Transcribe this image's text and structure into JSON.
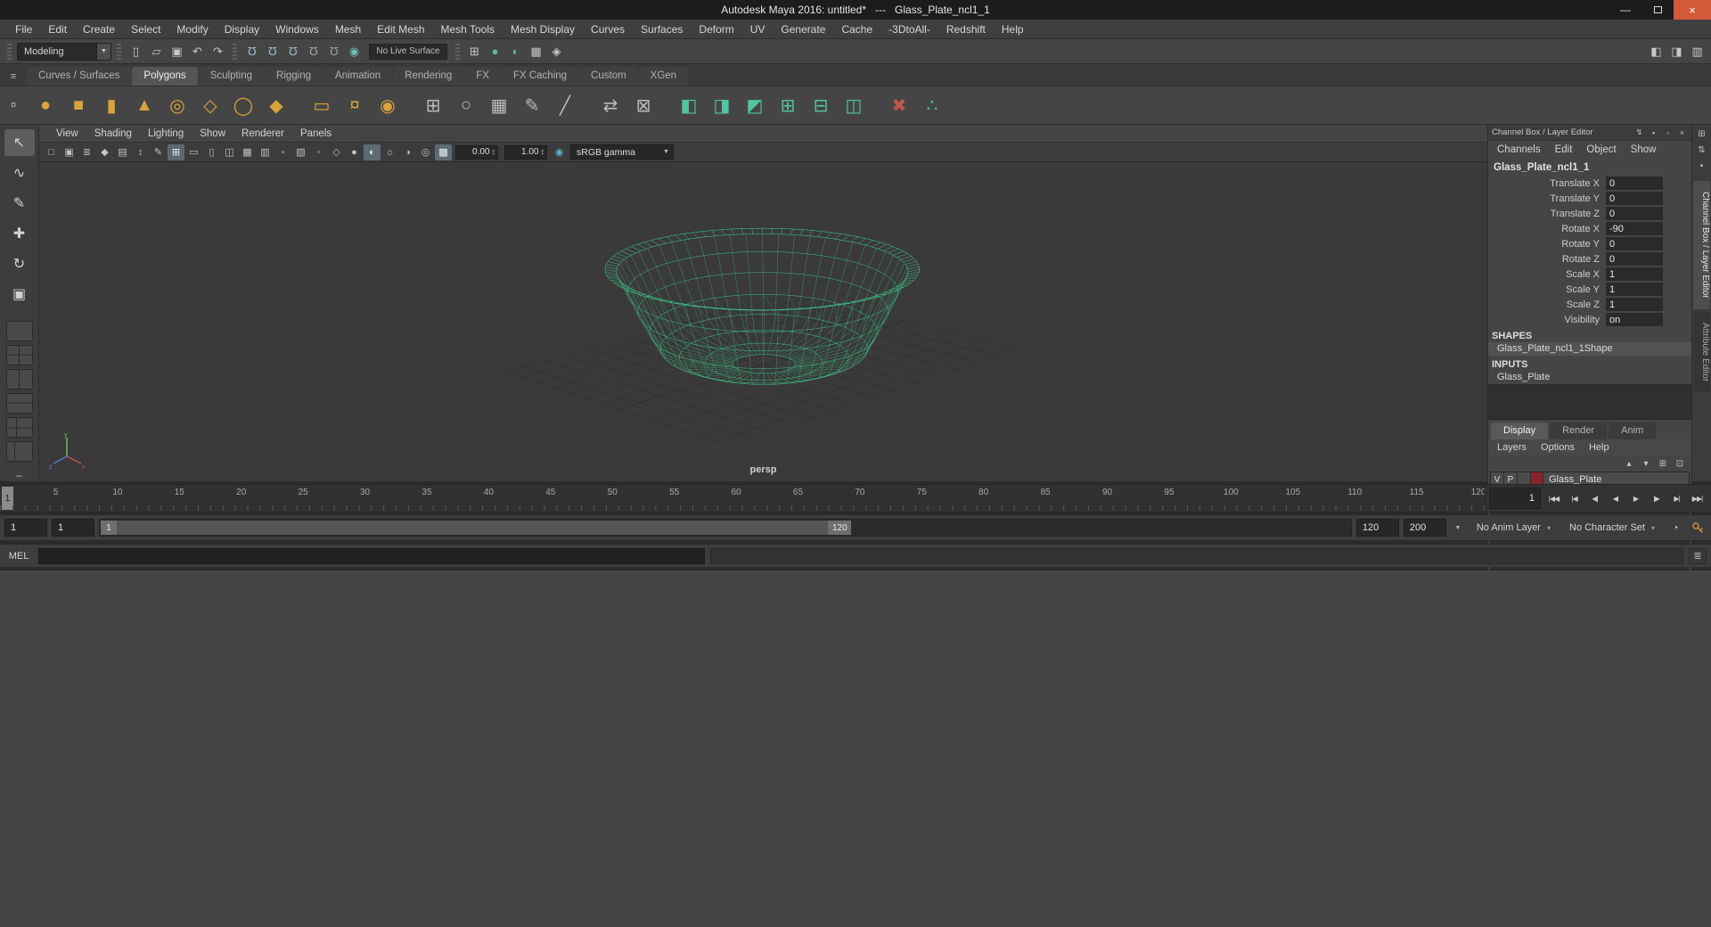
{
  "titlebar": {
    "title": "Autodesk Maya 2016: untitled*   ---   Glass_Plate_ncl1_1"
  },
  "menubar": {
    "items": [
      "File",
      "Edit",
      "Create",
      "Select",
      "Modify",
      "Display",
      "Windows",
      "Mesh",
      "Edit Mesh",
      "Mesh Tools",
      "Mesh Display",
      "Curves",
      "Surfaces",
      "Deform",
      "UV",
      "Generate",
      "Cache",
      "-3DtoAll-",
      "Redshift",
      "Help"
    ]
  },
  "statusline": {
    "menuset": "Modeling",
    "live_surface": "No Live Surface",
    "file_icons": [
      {
        "name": "new-scene-button",
        "icon": "new-scene-icon",
        "glyph": "▯"
      },
      {
        "name": "open-scene-button",
        "icon": "open-folder-icon",
        "glyph": "▱"
      },
      {
        "name": "save-scene-button",
        "icon": "save-icon",
        "glyph": "▣"
      },
      {
        "name": "undo-button",
        "icon": "undo-icon",
        "glyph": "↶"
      },
      {
        "name": "redo-button",
        "icon": "redo-icon",
        "glyph": "↷"
      }
    ],
    "snap_icons": [
      {
        "name": "snap-to-grid-button",
        "icon": "snap-grid-magnet-icon",
        "glyph": "Ω",
        "cls": "magnet",
        "color": "#9ec2d4"
      },
      {
        "name": "snap-to-curve-button",
        "icon": "snap-curve-magnet-icon",
        "glyph": "Ω",
        "cls": "magnet",
        "color": "#9ec2d4"
      },
      {
        "name": "snap-to-point-button",
        "icon": "snap-point-magnet-icon",
        "glyph": "Ω",
        "cls": "magnet",
        "color": "#9ec2d4"
      },
      {
        "name": "snap-to-projected-center-button",
        "icon": "snap-projected-magnet-icon",
        "glyph": "Ω",
        "cls": "magnet",
        "color": "#a9a9a9"
      },
      {
        "name": "snap-to-view-plane-button",
        "icon": "snap-view-plane-magnet-icon",
        "glyph": "Ω",
        "cls": "magnet",
        "color": "#a9a9a9"
      },
      {
        "name": "make-live-button",
        "icon": "make-live-icon",
        "glyph": "◉",
        "color": "#6fc0b5"
      }
    ],
    "render_icons": [
      {
        "name": "open-render-view-button",
        "icon": "render-view-icon",
        "glyph": "⊞"
      },
      {
        "name": "render-current-frame-button",
        "icon": "render-ball-icon",
        "glyph": "●",
        "color": "#5fb8a5"
      },
      {
        "name": "ipr-render-button",
        "icon": "ipr-render-icon",
        "glyph": "◐",
        "color": "#5fb8a5"
      },
      {
        "name": "render-settings-button",
        "icon": "render-settings-icon",
        "glyph": "▦"
      },
      {
        "name": "hypershade-button",
        "icon": "hypershade-icon",
        "glyph": "◈"
      }
    ],
    "right_icons": [
      {
        "name": "toggle-sidebar-left-button",
        "icon": "sidebar-left-icon",
        "glyph": "◧"
      },
      {
        "name": "toggle-sidebar-right-button",
        "icon": "sidebar-right-icon",
        "glyph": "◨"
      },
      {
        "name": "toggle-workspace-button",
        "icon": "workspace-grid-icon",
        "glyph": "▥"
      }
    ]
  },
  "shelf": {
    "menu_glyph": "≡",
    "gear_glyph": "¤",
    "tabs": [
      {
        "label": "Curves / Surfaces"
      },
      {
        "label": "Polygons",
        "active": true
      },
      {
        "label": "Sculpting"
      },
      {
        "label": "Rigging"
      },
      {
        "label": "Animation"
      },
      {
        "label": "Rendering"
      },
      {
        "label": "FX"
      },
      {
        "label": "FX Caching"
      },
      {
        "label": "Custom"
      },
      {
        "label": "XGen"
      }
    ],
    "icons": [
      {
        "name": "poly-sphere-button",
        "icon": "poly-sphere-icon",
        "glyph": "●",
        "color": "#d9a43c"
      },
      {
        "name": "poly-cube-button",
        "icon": "poly-cube-icon",
        "glyph": "■",
        "color": "#d9a43c"
      },
      {
        "name": "poly-cylinder-button",
        "icon": "poly-cylinder-icon",
        "glyph": "▮",
        "color": "#d9a43c"
      },
      {
        "name": "poly-cone-button",
        "icon": "poly-cone-icon",
        "glyph": "▲",
        "color": "#d9a43c"
      },
      {
        "name": "poly-torus-button",
        "icon": "poly-torus-icon",
        "glyph": "◎",
        "color": "#d9a43c"
      },
      {
        "name": "poly-plane-button",
        "icon": "poly-plane-icon",
        "glyph": "◇",
        "color": "#d9a43c"
      },
      {
        "name": "poly-disc-button",
        "icon": "poly-disc-icon",
        "glyph": "◯",
        "color": "#d9a43c"
      },
      {
        "name": "poly-platonic-button",
        "icon": "poly-platonic-icon",
        "glyph": "◆",
        "color": "#d9a43c"
      },
      {
        "name": "poly-pipe-button",
        "icon": "poly-pipe-icon",
        "glyph": "▭",
        "color": "#d9a43c",
        "gap": true
      },
      {
        "name": "poly-gear-button",
        "icon": "poly-gear-icon",
        "glyph": "¤",
        "color": "#d9a43c"
      },
      {
        "name": "poly-soccer-ball-button",
        "icon": "poly-soccer-ball-icon",
        "glyph": "◉",
        "color": "#d9a43c"
      },
      {
        "name": "sculpt-tool-button",
        "icon": "sculpt-grid-icon",
        "glyph": "⊞",
        "color": "#bcbcbc",
        "gap": true
      },
      {
        "name": "smooth-button",
        "icon": "smooth-icon",
        "glyph": "○",
        "color": "#bcbcbc"
      },
      {
        "name": "subdivide-button",
        "icon": "subdivide-icon",
        "glyph": "▦",
        "color": "#bcbcbc"
      },
      {
        "name": "quad-draw-button",
        "icon": "quad-draw-pencil-icon",
        "glyph": "✎",
        "color": "#bcbcbc"
      },
      {
        "name": "multi-cut-button",
        "icon": "multi-cut-icon",
        "glyph": "╱",
        "color": "#bcbcbc"
      },
      {
        "name": "target-weld-button",
        "icon": "target-weld-icon",
        "glyph": "⇄",
        "color": "#bcbcbc",
        "gap": true
      },
      {
        "name": "extrude-button",
        "icon": "extrude-icon",
        "glyph": "⊠",
        "color": "#bcbcbc"
      },
      {
        "name": "boolean-union-button",
        "icon": "boolean-union-icon",
        "glyph": "◧",
        "color": "#53c3a4",
        "gap": true
      },
      {
        "name": "boolean-difference-button",
        "icon": "boolean-difference-icon",
        "glyph": "◨",
        "color": "#53c3a4"
      },
      {
        "name": "boolean-intersection-button",
        "icon": "boolean-intersection-icon",
        "glyph": "◩",
        "color": "#53c3a4"
      },
      {
        "name": "combine-button",
        "icon": "combine-icon",
        "glyph": "⊞",
        "color": "#53c3a4"
      },
      {
        "name": "separate-button",
        "icon": "separate-icon",
        "glyph": "⊟",
        "color": "#53c3a4"
      },
      {
        "name": "mirror-button",
        "icon": "mirror-icon",
        "glyph": "◫",
        "color": "#53c3a4"
      },
      {
        "name": "delete-history-button",
        "icon": "delete-cross-icon",
        "glyph": "✖",
        "color": "#c0564a",
        "gap": true
      },
      {
        "name": "symmetry-button",
        "icon": "symmetry-icon",
        "glyph": "∴",
        "color": "#53c3a4"
      }
    ]
  },
  "toolbox": {
    "tools": [
      {
        "name": "select-tool",
        "icon": "select-arrow-icon",
        "glyph": "↖",
        "active": true
      },
      {
        "name": "lasso-tool",
        "icon": "lasso-icon",
        "glyph": "∿"
      },
      {
        "name": "paint-select-tool",
        "icon": "paint-brush-icon",
        "glyph": "✎"
      },
      {
        "name": "move-tool",
        "icon": "move-cross-icon",
        "glyph": "✚"
      },
      {
        "name": "rotate-tool",
        "icon": "rotate-icon",
        "glyph": "↻"
      },
      {
        "name": "scale-tool",
        "icon": "scale-icon",
        "glyph": "▣"
      }
    ],
    "layouts": [
      {
        "name": "layout-single-pane-button",
        "icon": "single-pane-icon",
        "cls": "lay-single"
      },
      {
        "name": "layout-four-pane-button",
        "icon": "four-pane-icon",
        "cls": "lay-four"
      },
      {
        "name": "layout-two-pane-side-button",
        "icon": "two-pane-side-icon",
        "cls": "lay-v"
      },
      {
        "name": "layout-two-pane-stacked-button",
        "icon": "two-pane-stacked-icon",
        "cls": "lay-h"
      },
      {
        "name": "layout-three-pane-button",
        "icon": "three-pane-icon",
        "cls": "lay-three"
      },
      {
        "name": "layout-outliner-persp-button",
        "icon": "outliner-pane-icon",
        "cls": "lay-left"
      }
    ],
    "more_glyph": "–"
  },
  "viewport": {
    "menus": [
      "View",
      "Shading",
      "Lighting",
      "Show",
      "Renderer",
      "Panels"
    ],
    "toolbar_icons": [
      {
        "name": "select-camera-button",
        "icon": "camera-icon",
        "glyph": "□"
      },
      {
        "name": "lock-camera-button",
        "icon": "lock-icon",
        "glyph": "▣"
      },
      {
        "name": "camera-attributes-button",
        "icon": "camera-attributes-icon",
        "glyph": "≣"
      },
      {
        "name": "bookmarks-button",
        "icon": "bookmark-icon",
        "glyph": "◆"
      },
      {
        "name": "image-plane-button",
        "icon": "image-plane-icon",
        "glyph": "▤"
      },
      {
        "name": "pan-zoom-button",
        "icon": "pan-zoom-icon",
        "glyph": "↕"
      },
      {
        "name": "grease-pencil-button",
        "icon": "grease-pencil-icon",
        "glyph": "✎"
      },
      {
        "name": "grid-toggle-button",
        "icon": "grid-icon",
        "glyph": "⊞",
        "active": true
      },
      {
        "name": "film-gate-button",
        "icon": "film-gate-icon",
        "glyph": "▭"
      },
      {
        "name": "resolution-gate-button",
        "icon": "resolution-gate-icon",
        "glyph": "▯"
      },
      {
        "name": "gate-mask-button",
        "icon": "gate-mask-icon",
        "glyph": "◫"
      },
      {
        "name": "field-chart-button",
        "icon": "field-chart-icon",
        "glyph": "▦"
      },
      {
        "name": "safe-action-button",
        "icon": "safe-action-icon",
        "glyph": "▥"
      },
      {
        "name": "safe-title-button",
        "icon": "safe-title-icon",
        "glyph": "▫"
      },
      {
        "name": "hud-button",
        "icon": "hud-icon",
        "glyph": "▧"
      },
      {
        "name": "xray-button",
        "icon": "xray-icon",
        "glyph": "◦"
      },
      {
        "name": "wireframe-mode-button",
        "icon": "wireframe-icon",
        "glyph": "◇"
      },
      {
        "name": "shaded-mode-button",
        "icon": "shaded-sphere-icon",
        "glyph": "●"
      },
      {
        "name": "textured-mode-button",
        "icon": "textured-sphere-icon",
        "glyph": "◐",
        "active": true
      },
      {
        "name": "use-all-lights-button",
        "icon": "lights-icon",
        "glyph": "☼"
      },
      {
        "name": "shadows-button",
        "icon": "shadows-icon",
        "glyph": "◑"
      },
      {
        "name": "ssao-button",
        "icon": "ambient-occlusion-icon",
        "glyph": "◎"
      },
      {
        "name": "anti-aliasing-button",
        "icon": "multisample-icon",
        "glyph": "▩",
        "active": true
      }
    ],
    "exposure": "0.00",
    "gamma": "1.00",
    "view_transform": "sRGB gamma",
    "camera_label": "persp"
  },
  "wireframe": {
    "color": "#3fe39b"
  },
  "channel_box": {
    "header": "Channel Box / Layer Editor",
    "header_icons": [
      {
        "name": "channel-speed-button",
        "icon": "lightning-icon",
        "glyph": "↯"
      },
      {
        "name": "channel-pin-button",
        "icon": "pin-icon",
        "glyph": "▪"
      },
      {
        "name": "float-panel-button",
        "icon": "float-panel-icon",
        "glyph": "▫"
      },
      {
        "name": "close-panel-button",
        "icon": "close-icon",
        "glyph": "×"
      }
    ],
    "menu": [
      "Channels",
      "Edit",
      "Object",
      "Show"
    ],
    "object_name": "Glass_Plate_ncl1_1",
    "attributes": [
      {
        "label": "Translate X",
        "value": "0"
      },
      {
        "label": "Translate Y",
        "value": "0"
      },
      {
        "label": "Translate Z",
        "value": "0"
      },
      {
        "label": "Rotate X",
        "value": "-90"
      },
      {
        "label": "Rotate Y",
        "value": "0"
      },
      {
        "label": "Rotate Z",
        "value": "0"
      },
      {
        "label": "Scale X",
        "value": "1"
      },
      {
        "label": "Scale Y",
        "value": "1"
      },
      {
        "label": "Scale Z",
        "value": "1"
      },
      {
        "label": "Visibility",
        "value": "on"
      }
    ],
    "shapes_header": "SHAPES",
    "shape_name": "Glass_Plate_ncl1_1Shape",
    "inputs_header": "INPUTS",
    "input_name": "Glass_Plate"
  },
  "layer_editor": {
    "tabs": [
      {
        "label": "Display",
        "active": true
      },
      {
        "label": "Render"
      },
      {
        "label": "Anim"
      }
    ],
    "menu": [
      "Layers",
      "Options",
      "Help"
    ],
    "icons": [
      {
        "name": "move-layer-up-button",
        "icon": "layer-up-icon",
        "glyph": "▴"
      },
      {
        "name": "move-layer-down-button",
        "icon": "layer-down-icon",
        "glyph": "▾"
      },
      {
        "name": "new-empty-layer-button",
        "icon": "new-layer-icon",
        "glyph": "⊞"
      },
      {
        "name": "new-layer-from-selected-button",
        "icon": "new-layer-selected-icon",
        "glyph": "⊡"
      }
    ],
    "layer": {
      "v": "V",
      "p": "P",
      "name": "Glass_Plate",
      "color": "#8b2331"
    }
  },
  "right_strip": {
    "icons": [
      {
        "name": "panel-grid-button",
        "icon": "grid-icon",
        "glyph": "⊞"
      },
      {
        "name": "panel-scroll-button",
        "icon": "up-down-arrows-icon",
        "glyph": "⇅"
      },
      {
        "name": "panel-pin-button",
        "icon": "pin-icon",
        "glyph": "▪"
      }
    ],
    "tabs": [
      {
        "label": "Channel Box / Layer Editor",
        "active": true
      },
      {
        "label": "Attribute Editor"
      }
    ]
  },
  "time_slider": {
    "current_frame": "1",
    "time_field": "1",
    "total_frames": 120,
    "ticks": [
      5,
      10,
      15,
      20,
      25,
      30,
      35,
      40,
      45,
      50,
      55,
      60,
      65,
      70,
      75,
      80,
      85,
      90,
      95,
      100,
      105,
      110,
      115,
      120
    ],
    "playback": [
      {
        "name": "go-to-range-start-button",
        "icon": "go-to-start-icon",
        "glyph": "|◀◀"
      },
      {
        "name": "step-back-frame-button",
        "icon": "step-back-frame-icon",
        "glyph": "|◀"
      },
      {
        "name": "step-back-key-button",
        "icon": "step-back-key-icon",
        "glyph": "◀|"
      },
      {
        "name": "play-backwards-button",
        "icon": "play-backwards-icon",
        "glyph": "◀"
      },
      {
        "name": "play-forwards-button",
        "icon": "play-forwards-icon",
        "glyph": "▶"
      },
      {
        "name": "step-forward-key-button",
        "icon": "step-forward-key-icon",
        "glyph": "|▶"
      },
      {
        "name": "step-forward-frame-button",
        "icon": "step-forward-frame-icon",
        "glyph": "▶|"
      },
      {
        "name": "go-to-range-end-button",
        "icon": "go-to-end-icon",
        "glyph": "▶▶|"
      }
    ]
  },
  "range_slider": {
    "anim_start": "1",
    "playback_start": "1",
    "handle_start": "1",
    "handle_end": "120",
    "playback_end": "120",
    "anim_end": "200",
    "range_fraction": 0.6,
    "anim_layer": "No Anim Layer",
    "character_set": "No Character Set"
  },
  "command_line": {
    "label": "MEL"
  }
}
